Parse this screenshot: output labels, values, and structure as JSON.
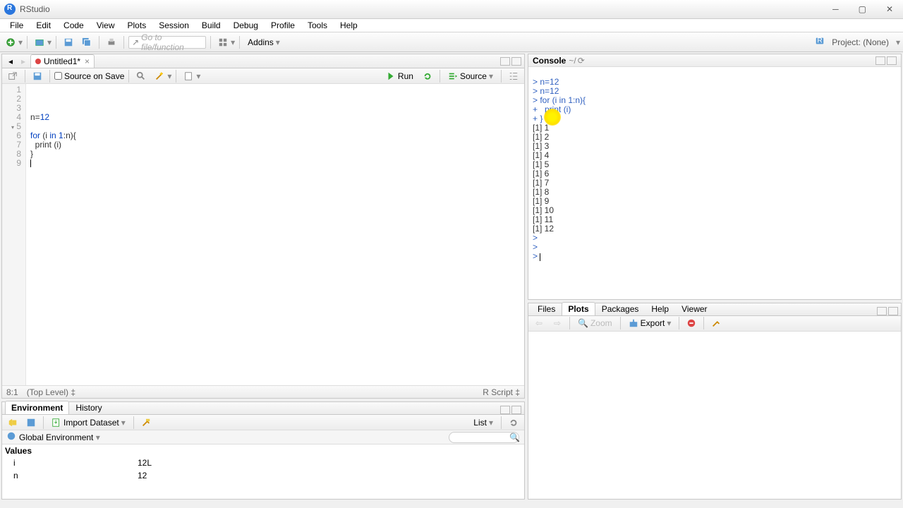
{
  "app": {
    "title": "RStudio"
  },
  "menu": [
    "File",
    "Edit",
    "Code",
    "View",
    "Plots",
    "Session",
    "Build",
    "Debug",
    "Profile",
    "Tools",
    "Help"
  ],
  "toolbar": {
    "goto_placeholder": "Go to file/function",
    "addins": "Addins",
    "project": "Project: (None)"
  },
  "source": {
    "tab_name": "Untitled1*",
    "source_on_save": "Source on Save",
    "run": "Run",
    "source_btn": "Source",
    "lines": [
      "1",
      "2",
      "3",
      "4",
      "5",
      "6",
      "7",
      "8",
      "9"
    ],
    "code_l3": "n=12",
    "code_l5": "for (i in 1:n){",
    "code_l6": "  print (i)",
    "code_l7": "}",
    "status_pos": "8:1",
    "status_scope": "(Top Level)",
    "status_lang": "R Script"
  },
  "console": {
    "title": "Console",
    "path": "~/",
    "lines": [
      "> n=12",
      "> n=12",
      "> for (i in 1:n){",
      "+   print (i)",
      "+ }",
      "[1] 1",
      "[1] 2",
      "[1] 3",
      "[1] 4",
      "[1] 5",
      "[1] 6",
      "[1] 7",
      "[1] 8",
      "[1] 9",
      "[1] 10",
      "[1] 11",
      "[1] 12",
      "> ",
      "> ",
      "> "
    ]
  },
  "env": {
    "tabs": [
      "Environment",
      "History"
    ],
    "import": "Import Dataset",
    "list": "List",
    "scope": "Global Environment",
    "section": "Values",
    "rows": [
      {
        "name": "i",
        "value": "12L"
      },
      {
        "name": "n",
        "value": "12"
      }
    ]
  },
  "files": {
    "tabs": [
      "Files",
      "Plots",
      "Packages",
      "Help",
      "Viewer"
    ],
    "zoom": "Zoom",
    "export": "Export"
  }
}
